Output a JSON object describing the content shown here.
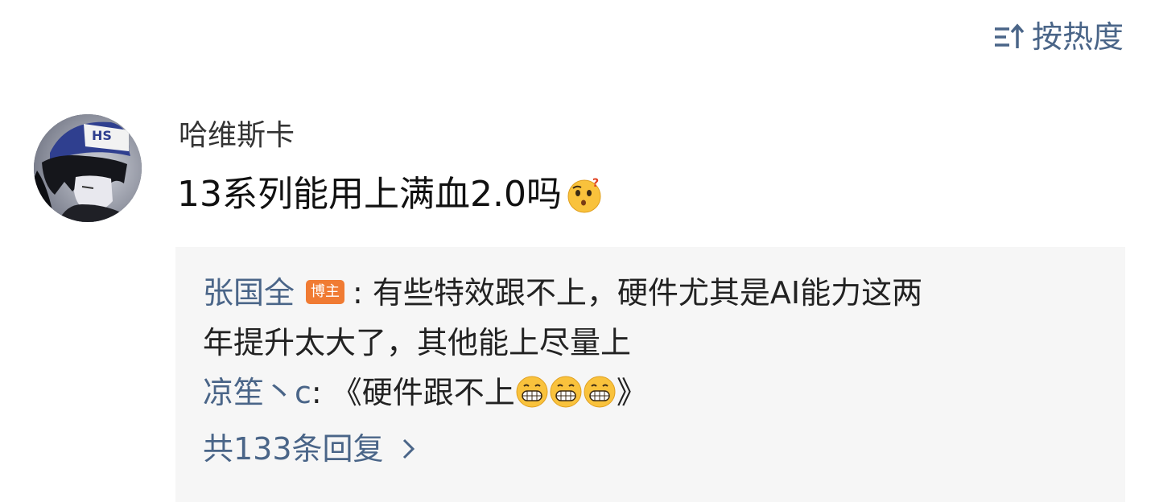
{
  "sort": {
    "icon": "sort-icon",
    "label": "按热度"
  },
  "comment": {
    "avatar_icon": "user-avatar",
    "username": "哈维斯卡",
    "text": "13系列能用上满血2.0吗",
    "emoji": "thinking-face-emoji"
  },
  "replies": [
    {
      "author": "张国全",
      "badge": "博主",
      "colon": ":",
      "text_line1": " 有些特效跟不上，硬件尤其是AI能力这两",
      "text_line2": "年提升太大了，其他能上尽量上"
    },
    {
      "author": "凉笙丶c",
      "colon": ":",
      "text_prefix": " 《硬件跟不上",
      "text_suffix": "》",
      "emoji": "grin-emoji",
      "emoji_count": 3
    }
  ],
  "more_replies": {
    "label": "共133条回复",
    "icon": "chevron-right-icon"
  },
  "colors": {
    "link": "#4a6588",
    "badge": "#f07b33",
    "reply_bg": "#f6f6f6"
  }
}
